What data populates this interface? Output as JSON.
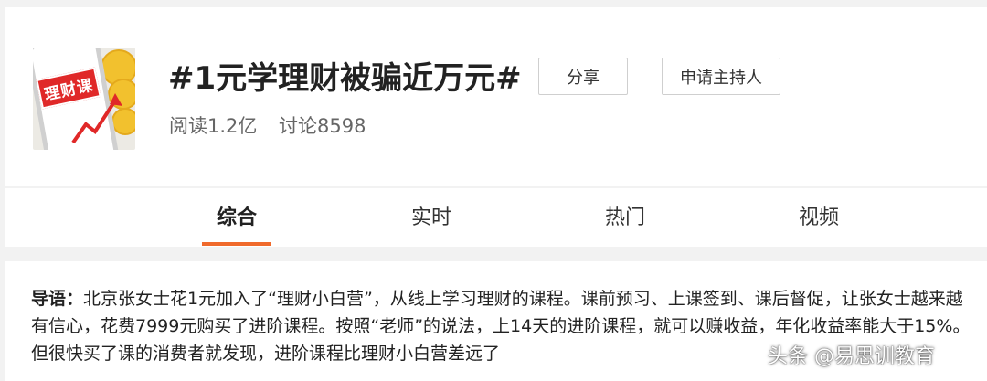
{
  "topic": {
    "title": "#1元学理财被骗近万元#",
    "cover_label": "理财课",
    "reads": "阅读1.2亿",
    "discussions": "讨论8598",
    "share_label": "分享",
    "host_label": "申请主持人"
  },
  "tabs": [
    {
      "label": "综合",
      "active": true
    },
    {
      "label": "实时",
      "active": false
    },
    {
      "label": "热门",
      "active": false
    },
    {
      "label": "视频",
      "active": false
    }
  ],
  "intro": {
    "label": "导语：",
    "text": "北京张女士花1元加入了“理财小白营”，从线上学习理财的课程。课前预习、上课签到、课后督促，让张女士越来越有信心，花费7999元购买了进阶课程。按照“老师”的说法，上14天的进阶课程，就可以赚收益，年化收益率能大于15%。但很快买了课的消费者就发现，进阶课程比理财小白营差远了"
  },
  "watermark": "头条 @易思训教育",
  "colors": {
    "accent": "#f06a2c",
    "cover_red": "#e02828",
    "background": "#f2f2f2"
  }
}
